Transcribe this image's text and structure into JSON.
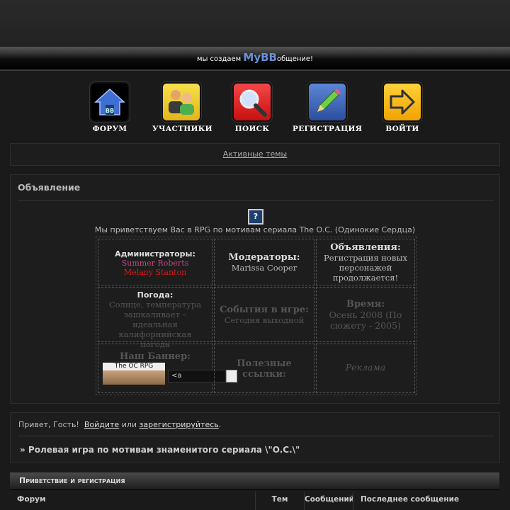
{
  "header": {
    "prefix": "мы создаем",
    "brand": "MyBB",
    "suffix": "общение!"
  },
  "nav": [
    {
      "label": "ФОРУМ",
      "icon": "home-icon"
    },
    {
      "label": "УЧАСТНИКИ",
      "icon": "users-icon"
    },
    {
      "label": "ПОИСК",
      "icon": "search-icon"
    },
    {
      "label": "РЕГИСТРАЦИЯ",
      "icon": "pencil-icon"
    },
    {
      "label": "ВОЙТИ",
      "icon": "login-arrow-icon"
    }
  ],
  "active_topics": "Активные темы",
  "announcement": {
    "title": "Объявление",
    "icon": "question-mark-icon",
    "welcome": "Мы приветствуем Вас в RPG по мотивам сериала The O.C. (Одинокие Сердца)",
    "admins_label": "Администраторы:",
    "admin1": "Summer Roberts",
    "admin2": "Melany Stanton",
    "mods_label": "Модераторы:",
    "mod1": "Marissa Cooper",
    "ads_label": "Объявления:",
    "ads_text": "Регистрация новых персонажей продолжается!",
    "weather_label": "Погода:",
    "weather_text": "Солнце, температура зашкаливает – идеальная калифорнийская погода",
    "events_label": "События в игре:",
    "events_text": "Сегодня выходной",
    "time_label": "Время:",
    "time_text": "Осень 2008 (По сюжету - 2005)",
    "banner_label": "Наш Баннер:",
    "banner_text": "The OC RPG",
    "banner_code": "<a",
    "links_label": "Полезные ссылки:",
    "ad_text": "Реклама"
  },
  "guest": {
    "greeting": "Привет, Гость!",
    "login": "Войдите",
    "or": "или",
    "register": "зарегистрируйтесь",
    "dot": ".",
    "tagline": "» Ролевая игра по мотивам знаменитого сериала \\\"O.C.\\\""
  },
  "category": {
    "title": "Приветствие и регистрация"
  },
  "table_headers": {
    "forum": "Форум",
    "topics": "Тем",
    "posts": "Сообщений",
    "last": "Последнее сообщение"
  },
  "colors": {
    "accent": "#6b8fd6",
    "admin1": "#c0457a",
    "admin2": "#e01818"
  }
}
